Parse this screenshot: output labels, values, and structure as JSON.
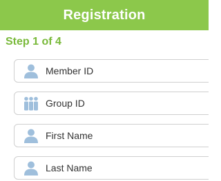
{
  "header": {
    "title": "Registration"
  },
  "step": {
    "text": "Step 1 of 4"
  },
  "fields": [
    {
      "label": "Member ID",
      "icon": "person-icon"
    },
    {
      "label": "Group ID",
      "icon": "group-icon"
    },
    {
      "label": "First Name",
      "icon": "person-icon"
    },
    {
      "label": "Last Name",
      "icon": "person-icon"
    }
  ],
  "colors": {
    "header_bg": "#8cc84b",
    "step_text": "#79b93a",
    "icon": "#9fbfdc",
    "border": "#cfcfcf"
  }
}
